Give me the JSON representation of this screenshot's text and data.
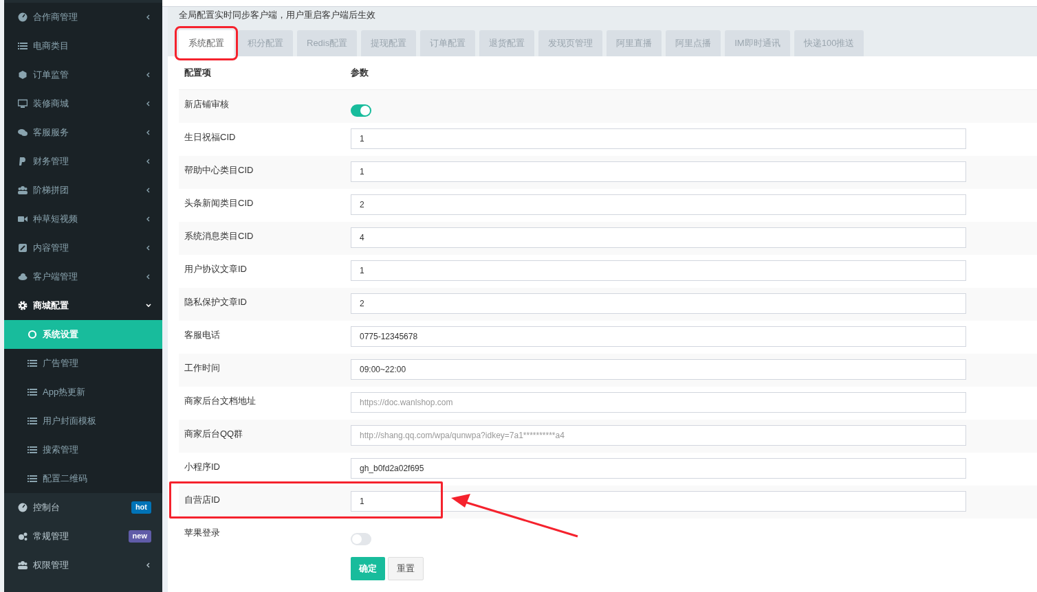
{
  "sidebar": {
    "submenu_items": [
      {
        "label": "合作商管理",
        "expanded": false
      },
      {
        "label": "电商类目"
      },
      {
        "label": "订单监管",
        "expanded": false
      },
      {
        "label": "装修商城",
        "expanded": false
      },
      {
        "label": "客服服务",
        "expanded": false
      },
      {
        "label": "财务管理",
        "expanded": false
      },
      {
        "label": "阶梯拼团",
        "expanded": false
      },
      {
        "label": "种草短视频",
        "expanded": false
      },
      {
        "label": "内容管理",
        "expanded": false
      },
      {
        "label": "客户端管理",
        "expanded": false
      },
      {
        "label": "商城配置",
        "expanded": true,
        "children": [
          {
            "label": "系统设置",
            "selected": true
          },
          {
            "label": "广告管理",
            "selected": false
          },
          {
            "label": "App热更新",
            "selected": false
          },
          {
            "label": "用户封面模板",
            "selected": false
          },
          {
            "label": "搜索管理",
            "selected": false
          },
          {
            "label": "配置二维码",
            "selected": false
          }
        ]
      }
    ],
    "items": [
      {
        "label": "控制台",
        "badge": {
          "text": "hot",
          "color": "#0073b7"
        }
      },
      {
        "label": "常规管理",
        "badge": {
          "text": "new",
          "color": "#605ca8"
        }
      },
      {
        "label": "权限管理",
        "expanded": false
      }
    ]
  },
  "notice": "全局配置实时同步客户端，用户重启客户端后生效",
  "tabs": [
    {
      "label": "系统配置",
      "selected": true,
      "highlighted": true
    },
    {
      "label": "积分配置",
      "selected": false,
      "highlighted": false
    },
    {
      "label": "Redis配置",
      "selected": false,
      "highlighted": false
    },
    {
      "label": "提现配置",
      "selected": false,
      "highlighted": false
    },
    {
      "label": "订单配置",
      "selected": false,
      "highlighted": false
    },
    {
      "label": "退货配置",
      "selected": false,
      "highlighted": false
    },
    {
      "label": "发现页管理",
      "selected": false,
      "highlighted": false
    },
    {
      "label": "阿里直播",
      "selected": false,
      "highlighted": false
    },
    {
      "label": "阿里点播",
      "selected": false,
      "highlighted": false
    },
    {
      "label": "IM即时通讯",
      "selected": false,
      "highlighted": false
    },
    {
      "label": "快递100推送",
      "selected": false,
      "highlighted": false
    }
  ],
  "table": {
    "columns": [
      "配置项",
      "参数"
    ],
    "rows": [
      {
        "label": "新店铺审核",
        "kind": "switch",
        "on": true
      },
      {
        "label": "生日祝福CID",
        "kind": "text",
        "value": "1"
      },
      {
        "label": "帮助中心类目CID",
        "kind": "text",
        "value": "1"
      },
      {
        "label": "头条新闻类目CID",
        "kind": "text",
        "value": "2"
      },
      {
        "label": "系统消息类目CID",
        "kind": "text",
        "value": "4"
      },
      {
        "label": "用户协议文章ID",
        "kind": "text",
        "value": "1"
      },
      {
        "label": "隐私保护文章ID",
        "kind": "text",
        "value": "2"
      },
      {
        "label": "客服电话",
        "kind": "text",
        "value": "0775-12345678"
      },
      {
        "label": "工作时间",
        "kind": "text",
        "value": "09:00~22:00"
      },
      {
        "label": "商家后台文档地址",
        "kind": "text",
        "placeholder": "https://doc.wanlshop.com"
      },
      {
        "label": "商家后台QQ群",
        "kind": "text",
        "placeholder": "http://shang.qq.com/wpa/qunwpa?idkey=7a1**********a4"
      },
      {
        "label": "小程序ID",
        "kind": "text",
        "value": "gh_b0fd2a02f695"
      },
      {
        "label": "自营店ID",
        "kind": "text",
        "value": "1",
        "highlighted": true
      },
      {
        "label": "苹果登录",
        "kind": "switch",
        "on": false
      }
    ]
  },
  "buttons": [
    {
      "label": "确定",
      "kind": "primary"
    },
    {
      "label": "重置",
      "kind": "default"
    }
  ]
}
